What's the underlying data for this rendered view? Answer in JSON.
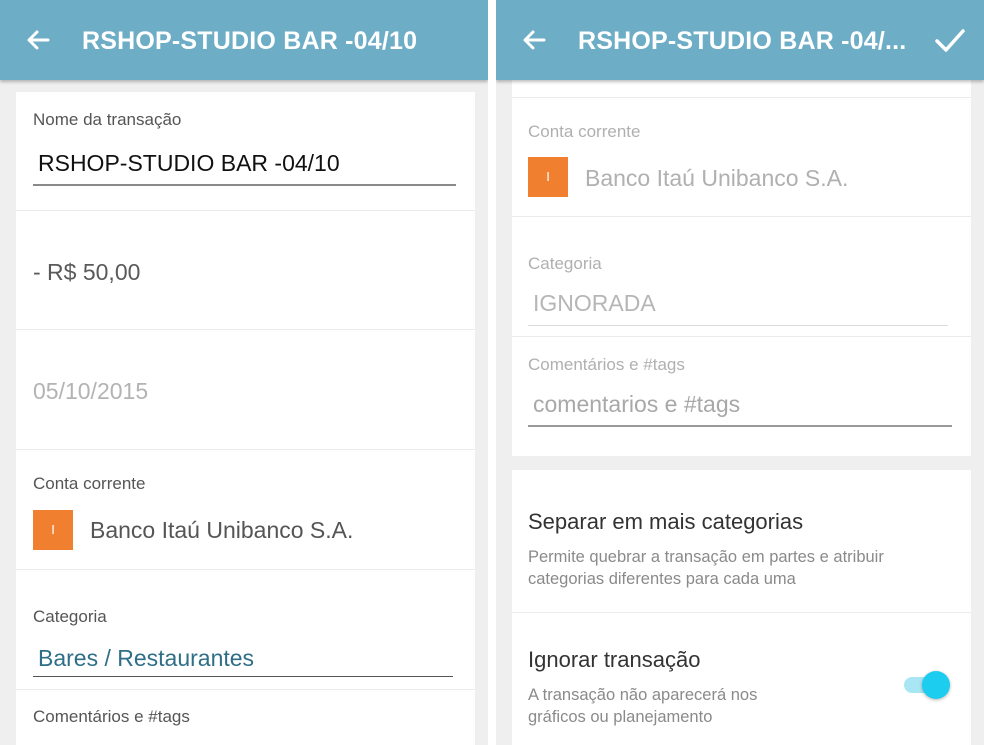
{
  "colors": {
    "appbar": "#6eadc6",
    "bank_icon": "#f0802f",
    "category_link": "#2e6f87",
    "toggle_on": "#1ccdf0"
  },
  "left": {
    "appbar": {
      "back_icon": "arrow-back-icon",
      "title": "RSHOP-STUDIO BAR -04/10"
    },
    "name_label": "Nome da transação",
    "name_value": "RSHOP-STUDIO BAR -04/10",
    "amount": "- R$ 50,00",
    "date": "05/10/2015",
    "account_label": "Conta corrente",
    "bank_icon_letter": "I",
    "bank_name": "Banco Itaú Unibanco S.A.",
    "category_label": "Categoria",
    "category_value": "Bares / Restaurantes",
    "comments_label": "Comentários e #tags"
  },
  "right": {
    "appbar": {
      "back_icon": "arrow-back-icon",
      "title": "RSHOP-STUDIO BAR -04/...",
      "check_icon": "check-icon"
    },
    "account_label": "Conta corrente",
    "bank_icon_letter": "I",
    "bank_name": "Banco Itaú Unibanco S.A.",
    "category_label": "Categoria",
    "category_value": "IGNORADA",
    "comments_label": "Comentários e #tags",
    "comments_placeholder": "comentarios e #tags",
    "split": {
      "title": "Separar em mais categorias",
      "desc_line1": "Permite quebrar a transação em partes e atribuir",
      "desc_line2": "categorias diferentes para cada uma"
    },
    "ignore": {
      "title": "Ignorar transação",
      "desc_line1": "A transação não aparecerá nos",
      "desc_line2": "gráficos ou planejamento",
      "enabled": true
    }
  }
}
